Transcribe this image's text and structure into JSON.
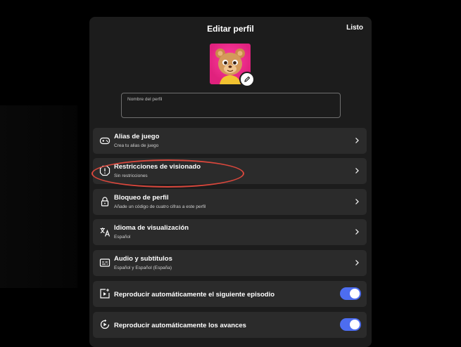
{
  "header": {
    "title": "Editar perfil",
    "done_label": "Listo"
  },
  "avatar": {
    "icon": "bear-cub-avatar",
    "edit_icon": "pencil-icon",
    "background": "#e0217d"
  },
  "name_field": {
    "label": "Nombre del perfil",
    "value": ""
  },
  "settings": [
    {
      "label": "Alias de juego",
      "sub": "Crea tu alias de juego",
      "icon": "gamepad-icon"
    },
    {
      "label": "Restricciones de visionado",
      "sub": "Sin restricciones",
      "icon": "warning-icon"
    },
    {
      "label": "Bloqueo de perfil",
      "sub": "Añade un código de cuatro cifras a este perfil",
      "icon": "lock-icon"
    },
    {
      "label": "Idioma de visualización",
      "sub": "Español",
      "icon": "translate-icon"
    },
    {
      "label": "Audio y subtítulos",
      "sub": "Español y Español (España)",
      "icon": "subtitles-icon"
    }
  ],
  "toggles": [
    {
      "label": "Reproducir automáticamente el siguiente episodio",
      "icon": "next-episode-icon",
      "on": true
    },
    {
      "label": "Reproducir automáticamente los avances",
      "icon": "autoplay-previews-icon",
      "on": true
    }
  ],
  "colors": {
    "toggle_on": "#4d6df0",
    "annotation": "#d9473c",
    "row_bg": "#2b2b2b",
    "modal_bg": "#1c1c1c"
  }
}
